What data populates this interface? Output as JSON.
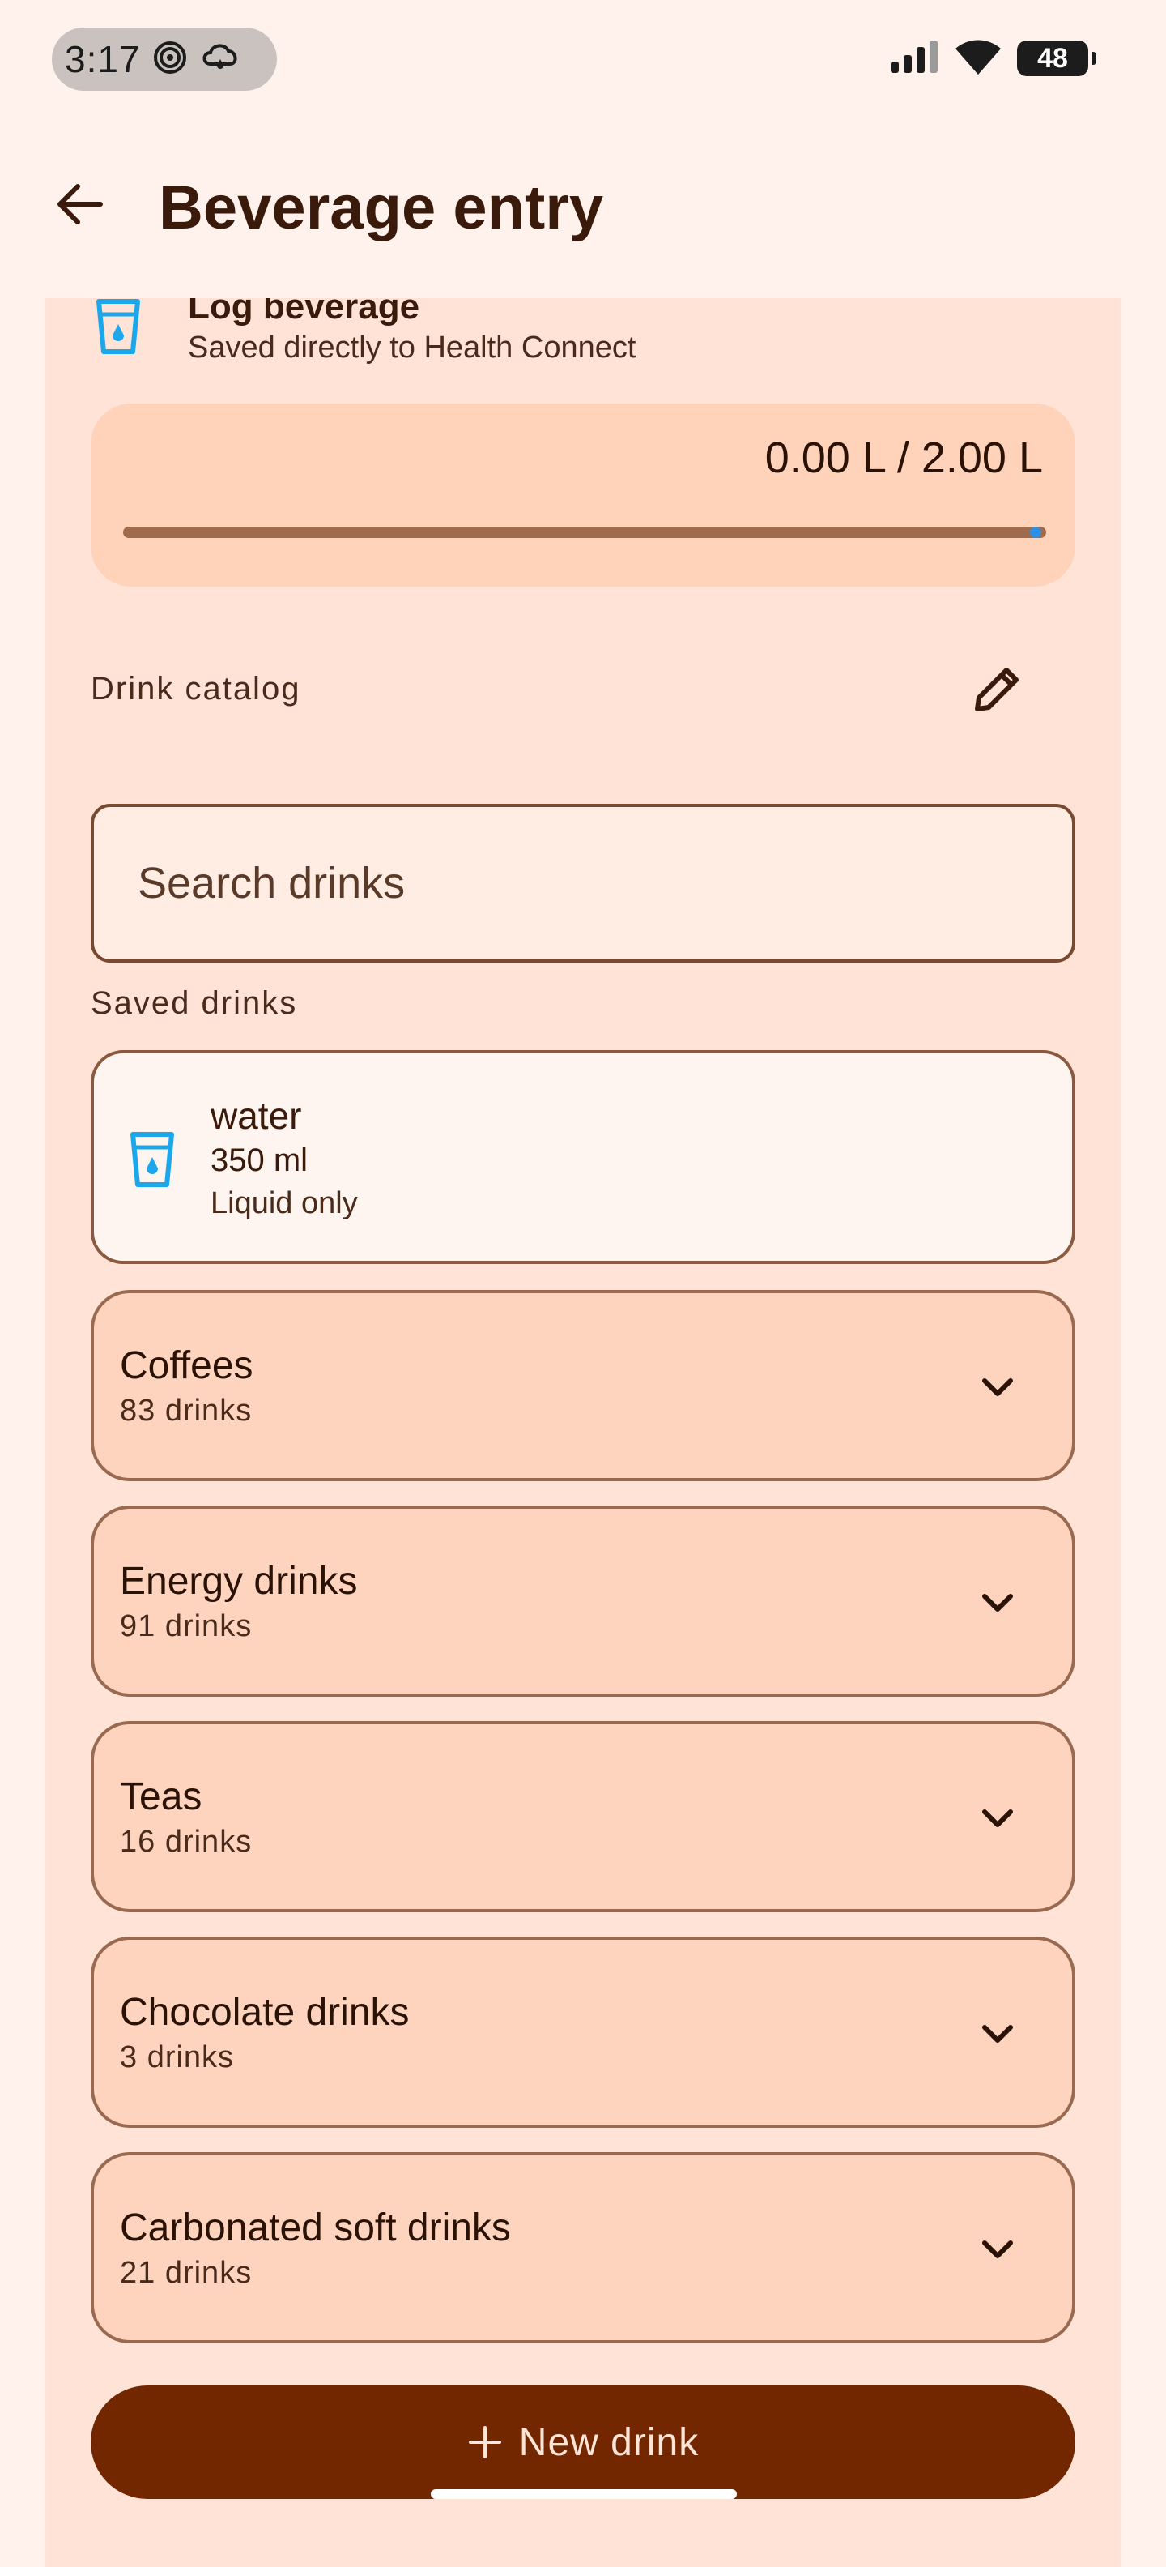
{
  "status_bar": {
    "time": "3:17",
    "battery": "48"
  },
  "app_bar": {
    "title": "Beverage entry"
  },
  "log": {
    "title": "Log beverage",
    "subtitle": "Saved directly to Health Connect"
  },
  "progress": {
    "text": "0.00 L / 2.00 L",
    "current_l": 0.0,
    "goal_l": 2.0
  },
  "catalog": {
    "label": "Drink catalog",
    "search_placeholder": "Search drinks",
    "saved_label": "Saved drinks",
    "saved": [
      {
        "name": "water",
        "volume": "350 ml",
        "type": "Liquid only"
      }
    ],
    "categories": [
      {
        "name": "Coffees",
        "count": "83 drinks"
      },
      {
        "name": "Energy drinks",
        "count": "91 drinks"
      },
      {
        "name": "Teas",
        "count": "16 drinks"
      },
      {
        "name": "Chocolate drinks",
        "count": "3 drinks"
      },
      {
        "name": "Carbonated soft drinks",
        "count": "21 drinks"
      }
    ]
  },
  "new_drink_label": "New drink",
  "colors": {
    "accent": "#722700",
    "surface": "#FFE3D6",
    "card": "#FFD4BE",
    "icon_blue": "#1AA7EC"
  }
}
